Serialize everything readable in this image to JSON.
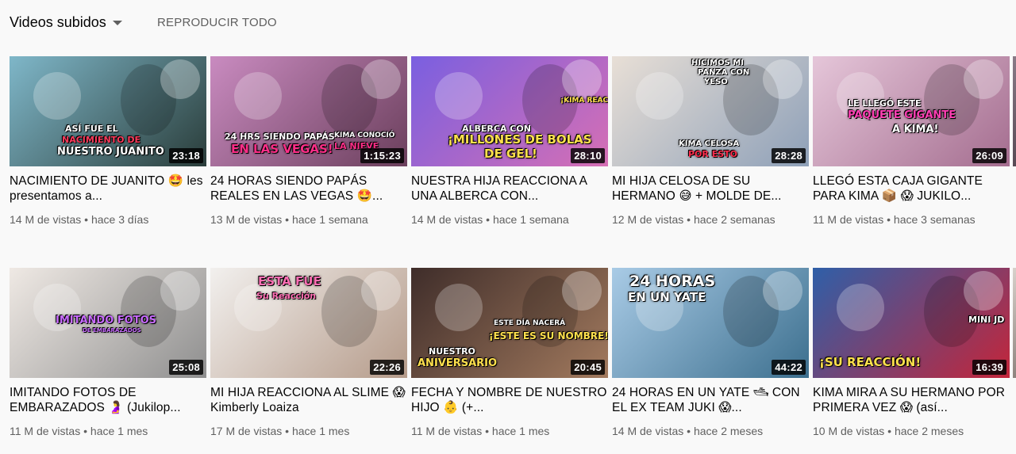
{
  "header": {
    "sort_label": "Videos subidos",
    "play_all_label": "REPRODUCIR TODO"
  },
  "rows": [
    [
      {
        "title": "NACIMIENTO DE JUANITO 🤩 les presentamos a...",
        "views": "14 M de vistas",
        "age": "hace 3 días",
        "duration": "23:18",
        "overlay": [
          "ASÍ FUE EL",
          "NACIMIENTO DE",
          "NUESTRO JUANITO"
        ],
        "colors": {
          "bg1": "#7fb7c9",
          "bg2": "#2a3d3a"
        }
      },
      {
        "title": "24 HORAS SIENDO PAPÁS REALES EN LAS VEGAS 🤩...",
        "views": "13 M de vistas",
        "age": "hace 1 semana",
        "duration": "1:15:23",
        "overlay": [
          "24 HRS SIENDO PAPÁS",
          "EN LAS VEGAS!",
          "KIMA CONOCIÓ",
          "LA NIEVE"
        ],
        "colors": {
          "bg1": "#c98bc0",
          "bg2": "#6b3f5c"
        }
      },
      {
        "title": "NUESTRA HIJA REACCIONA A UNA ALBERCA CON...",
        "views": "14 M de vistas",
        "age": "hace 1 semana",
        "duration": "28:10",
        "overlay": [
          "ALBERCA CON",
          "¡MILLONES DE BOLAS",
          "DE GEL!",
          "¡KIMA REACCIONA!"
        ],
        "colors": {
          "bg1": "#7a5fe0",
          "bg2": "#d66fb4"
        }
      },
      {
        "title": "MI HIJA CELOSA DE SU HERMANO 😅 + MOLDE DE...",
        "views": "12 M de vistas",
        "age": "hace 2 semanas",
        "duration": "28:28",
        "overlay": [
          "HICIMOS MI",
          "PANZA CON",
          "YESO",
          "KIMA CELOSA",
          "POR ESTO"
        ],
        "colors": {
          "bg1": "#e8dfd6",
          "bg2": "#8ea0b8"
        }
      },
      {
        "title": "LLEGÓ ESTA CAJA GIGANTE PARA KIMA 📦 😱 JUKILO...",
        "views": "11 M de vistas",
        "age": "hace 3 semanas",
        "duration": "26:09",
        "overlay": [
          "LE LLEGÓ ESTE",
          "PAQUETE GIGANTE",
          "A KIMA!"
        ],
        "colors": {
          "bg1": "#e5c6d9",
          "bg2": "#a46d8f"
        }
      }
    ],
    [
      {
        "title": "IMITANDO FOTOS DE EMBARAZADOS 🤰 (Jukilop...",
        "views": "11 M de vistas",
        "age": "hace 1 mes",
        "duration": "25:08",
        "overlay": [
          "IMITANDO FOTOS",
          "DE EMBARAZADOS"
        ],
        "colors": {
          "bg1": "#efe9e4",
          "bg2": "#8f8f8f"
        }
      },
      {
        "title": "MI HIJA REACCIONA AL SLIME 😱 Kimberly Loaiza",
        "views": "17 M de vistas",
        "age": "hace 1 mes",
        "duration": "22:26",
        "overlay": [
          "ESTA FUE",
          "Su Reacción"
        ],
        "colors": {
          "bg1": "#f2f0ee",
          "bg2": "#b59b8a"
        }
      },
      {
        "title": "FECHA Y NOMBRE DE NUESTRO HIJO 👶 (+...",
        "views": "11 M de vistas",
        "age": "hace 1 mes",
        "duration": "20:45",
        "overlay": [
          "ESTE DÍA NACERÁ",
          "¡ESTE ES SU NOMBRE!",
          "NUESTRO",
          "ANIVERSARIO"
        ],
        "colors": {
          "bg1": "#3f2d2a",
          "bg2": "#a27a5e"
        }
      },
      {
        "title": "24 HORAS EN UN YATE 🛥 CON EL EX TEAM JUKI 😱...",
        "views": "14 M de vistas",
        "age": "hace 2 meses",
        "duration": "44:22",
        "overlay": [
          "24 HORAS",
          "EN UN YATE"
        ],
        "colors": {
          "bg1": "#a9cbe6",
          "bg2": "#3c6f8e"
        }
      },
      {
        "title": "KIMA MIRA A SU HERMANO POR PRIMERA VEZ 😱 (así...",
        "views": "10 M de vistas",
        "age": "hace 2 meses",
        "duration": "16:39",
        "overlay": [
          "¡SU REACCIÓN!",
          "MINI JD"
        ],
        "colors": {
          "bg1": "#2f5fa8",
          "bg2": "#c4253a"
        }
      }
    ]
  ]
}
